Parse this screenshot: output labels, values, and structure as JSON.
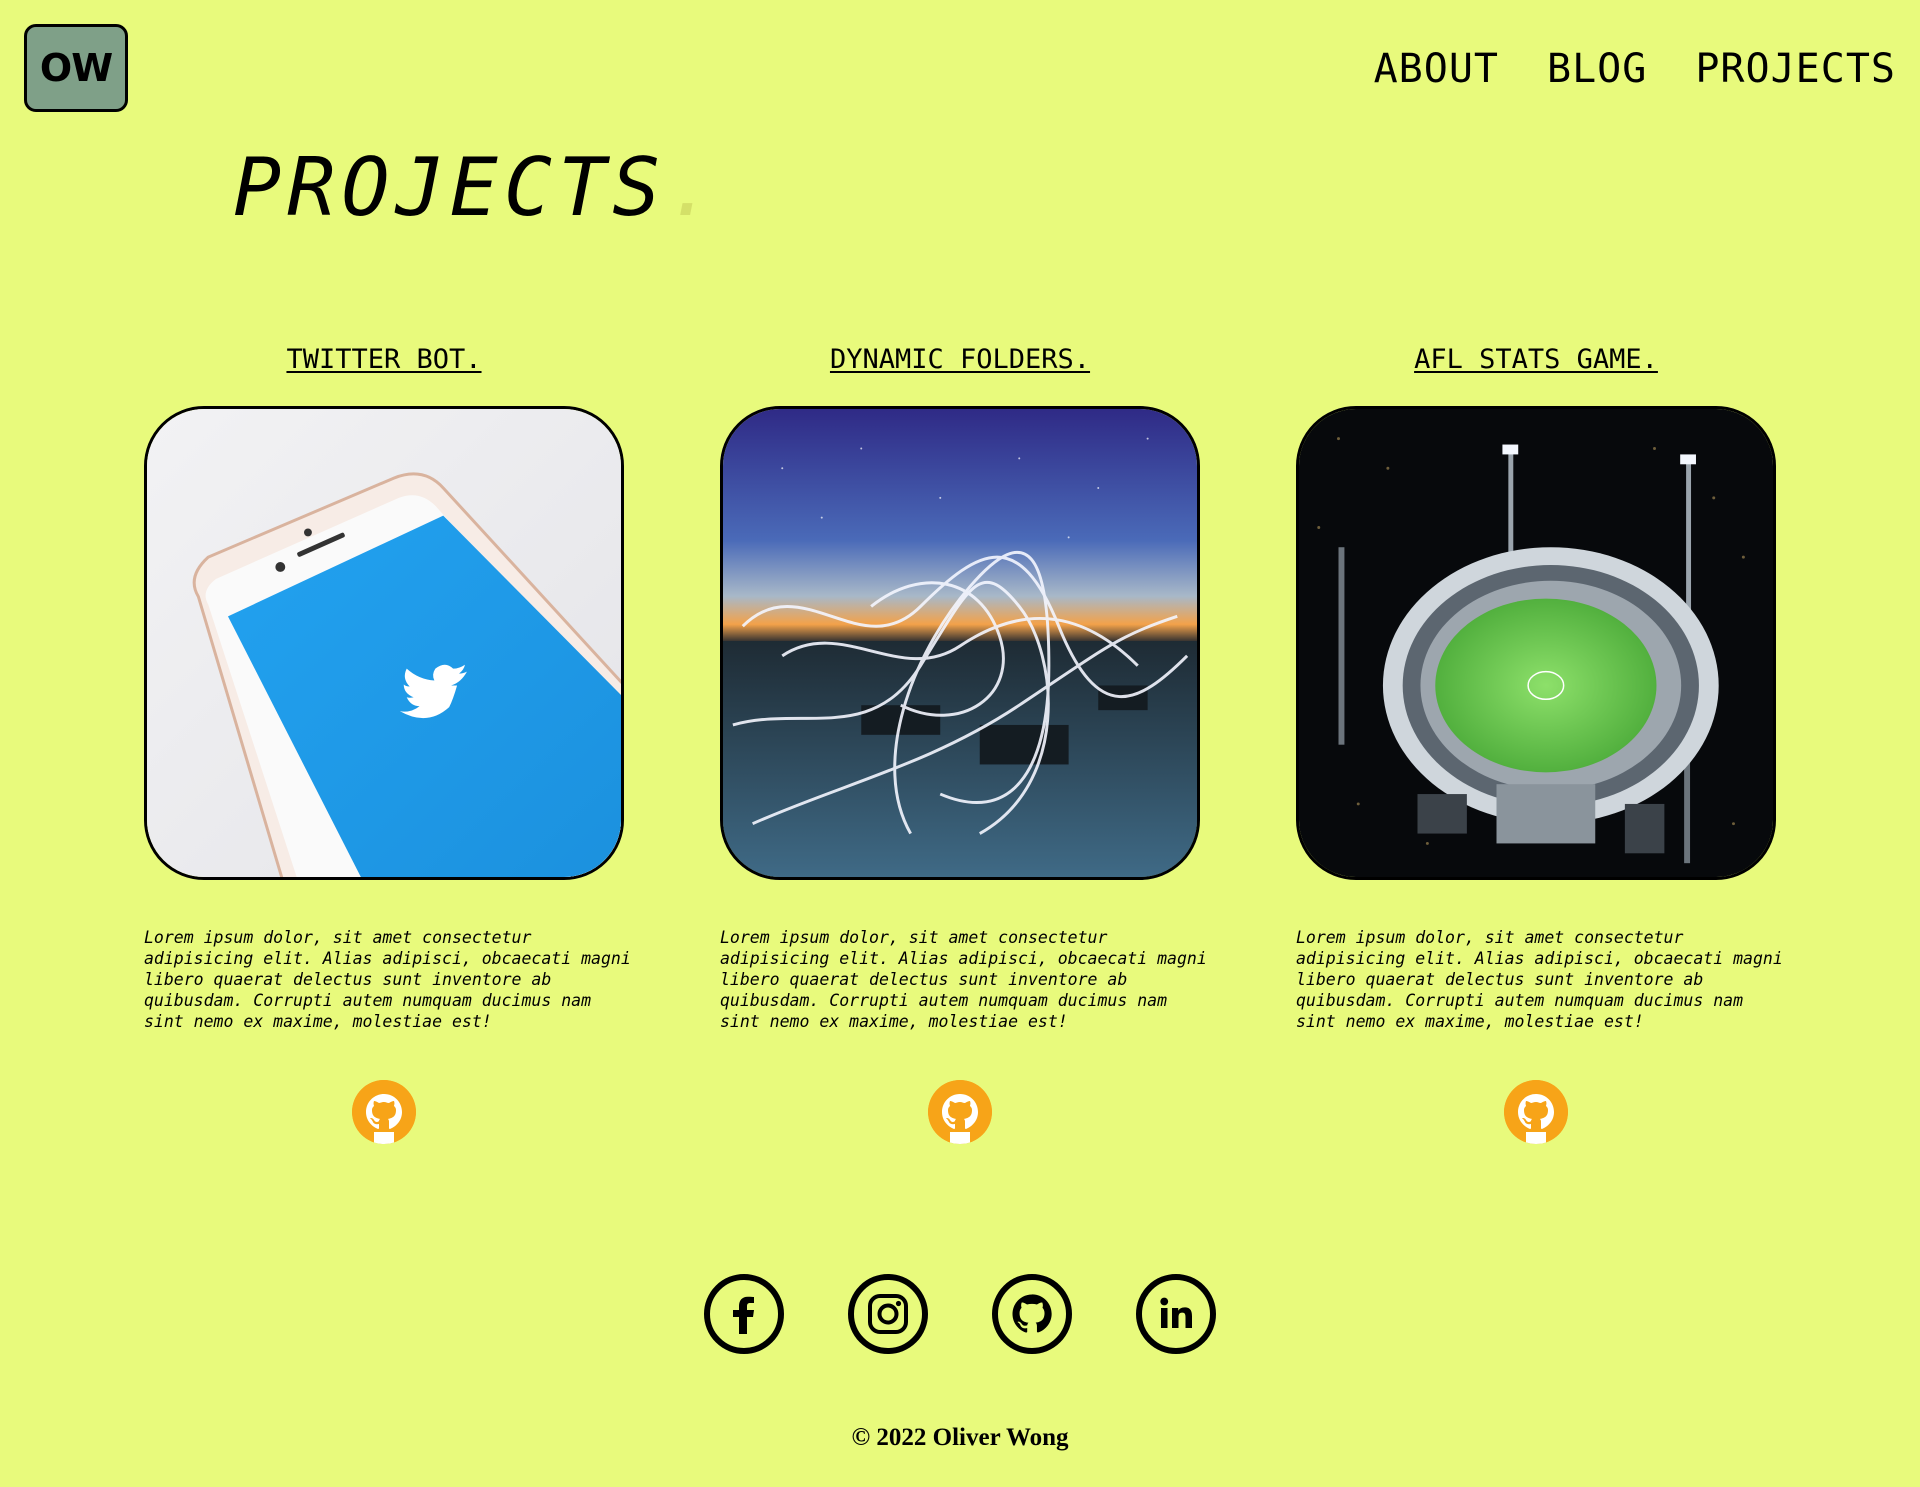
{
  "header": {
    "logo_text": "OW",
    "nav": [
      {
        "label": "ABOUT"
      },
      {
        "label": "BLOG"
      },
      {
        "label": "PROJECTS"
      }
    ]
  },
  "page": {
    "title": "PROJECTS",
    "title_dot": "."
  },
  "projects": [
    {
      "title": "TWITTER BOT.",
      "description": "Lorem ipsum dolor, sit amet consectetur adipisicing elit. Alias adipisci, obcaecati magni libero quaerat delectus sunt inventore ab quibusdam. Corrupti autem numquam ducimus nam sint nemo ex maxime, molestiae est!",
      "icon": "github-icon"
    },
    {
      "title": "DYNAMIC FOLDERS.",
      "description": "Lorem ipsum dolor, sit amet consectetur adipisicing elit. Alias adipisci, obcaecati magni libero quaerat delectus sunt inventore ab quibusdam. Corrupti autem numquam ducimus nam sint nemo ex maxime, molestiae est!",
      "icon": "github-icon"
    },
    {
      "title": "AFL STATS GAME.",
      "description": "Lorem ipsum dolor, sit amet consectetur adipisicing elit. Alias adipisci, obcaecati magni libero quaerat delectus sunt inventore ab quibusdam. Corrupti autem numquam ducimus nam sint nemo ex maxime, molestiae est!",
      "icon": "github-icon"
    }
  ],
  "social": [
    "facebook-icon",
    "instagram-icon",
    "github-icon",
    "linkedin-icon"
  ],
  "footer": {
    "text": "© 2022 Oliver Wong"
  },
  "colors": {
    "background": "#e8fa7c",
    "logo_bg": "#7fa088",
    "github_badge": "#f7a418",
    "text": "#000000"
  }
}
